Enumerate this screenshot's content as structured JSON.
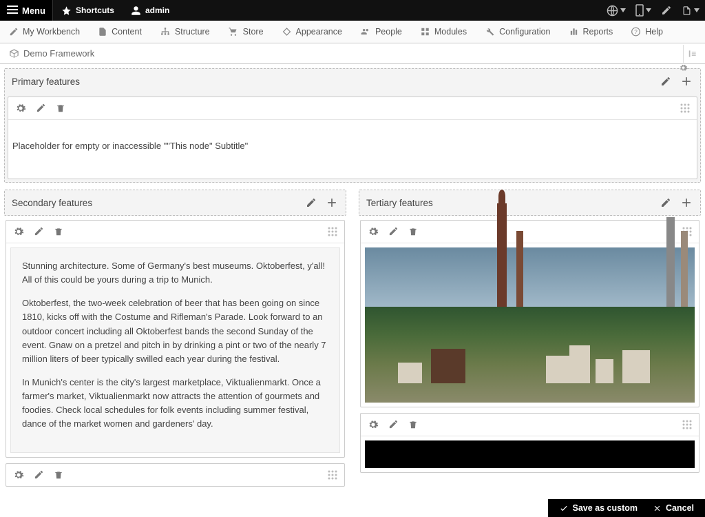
{
  "topbar": {
    "menu": "Menu",
    "shortcuts": "Shortcuts",
    "user": "admin"
  },
  "admintoolbar": {
    "items": [
      "My Workbench",
      "Content",
      "Structure",
      "Store",
      "Appearance",
      "People",
      "Modules",
      "Configuration",
      "Reports",
      "Help"
    ]
  },
  "secrow": {
    "label": "Demo Framework"
  },
  "regions": {
    "primary": {
      "title": "Primary features",
      "placeholder": "Placeholder for empty or inaccessible \"\"This node\" Subtitle\""
    },
    "secondary": {
      "title": "Secondary features",
      "article_p1": "Stunning architecture. Some of Germany's best museums. Oktoberfest, y'all! All of this could be yours during a trip to Munich.",
      "article_p2": "Oktoberfest, the two-week celebration of beer that has been going on since 1810, kicks off with the Costume and Rifleman's Parade. Look forward to an outdoor concert including all Oktoberfest bands the second Sunday of the event. Gnaw on a pretzel and pitch in by drinking a pint or two of the nearly 7 million liters of beer typically swilled each year during the festival.",
      "article_p3": "In Munich's center is the city's largest marketplace, Viktualienmarkt. Once a farmer's market, Viktualienmarkt now attracts the attention of gourmets and foodies. Check local schedules for folk events including summer festival, dance of the market women and gardeners' day."
    },
    "tertiary": {
      "title": "Tertiary features"
    }
  },
  "savebar": {
    "save": "Save as custom",
    "cancel": "Cancel"
  }
}
